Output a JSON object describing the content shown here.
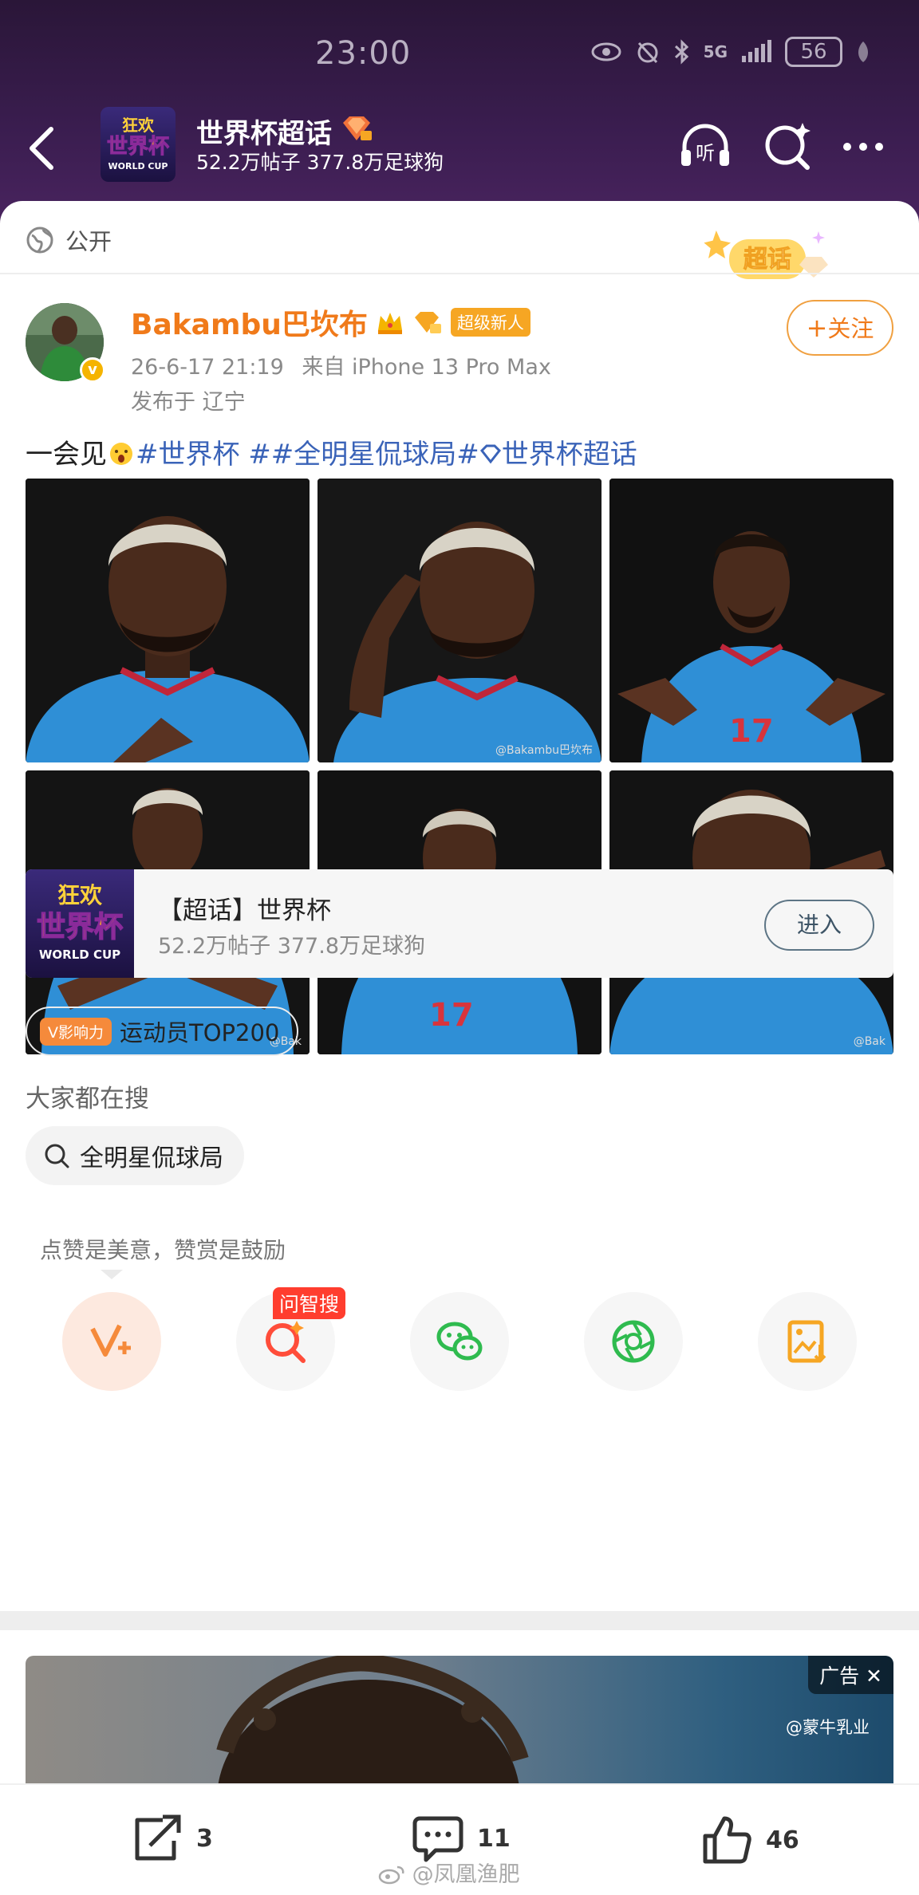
{
  "status_bar": {
    "time": "23:00",
    "network": "5G",
    "battery": "56"
  },
  "header": {
    "topic_title": "世界杯超话",
    "topic_stats": "52.2万帖子 377.8万足球狗",
    "topic_logo_text": [
      "狂欢",
      "世界杯",
      "WORLD CUP"
    ]
  },
  "post": {
    "visibility": "公开",
    "chaohua_badge": "超话",
    "author": {
      "name": "Bakambu巴坎布",
      "badge": "超级新人",
      "time": "26-6-17 21:19",
      "source": "来自 iPhone 13 Pro Max",
      "location": "发布于 辽宁"
    },
    "follow_label": "关注",
    "text_prefix": "一会见",
    "tag1": "#世界杯 #",
    "tag2": "#全明星侃球局#",
    "tag3": "世界杯超话",
    "photo_watermark": "@Bakambu巴坎布",
    "photo_watermark_short": "@Bak",
    "photo_jersey_number": "17"
  },
  "topic_card": {
    "title": "【超话】世界杯",
    "subtitle": "52.2万帖子 377.8万足球狗",
    "enter_label": "进入"
  },
  "influence": {
    "tag": "V影响力",
    "label": "运动员TOP200"
  },
  "search": {
    "title": "大家都在搜",
    "chip": "全明星侃球局"
  },
  "tip": "点赞是美意，赞赏是鼓励",
  "wenzhi_badge": "问智搜",
  "ad": {
    "tag": "广告",
    "brand": "@蒙牛乳业"
  },
  "bottom": {
    "repost": "3",
    "comment": "11",
    "like": "46"
  },
  "watermark": "@凤凰渔肥"
}
